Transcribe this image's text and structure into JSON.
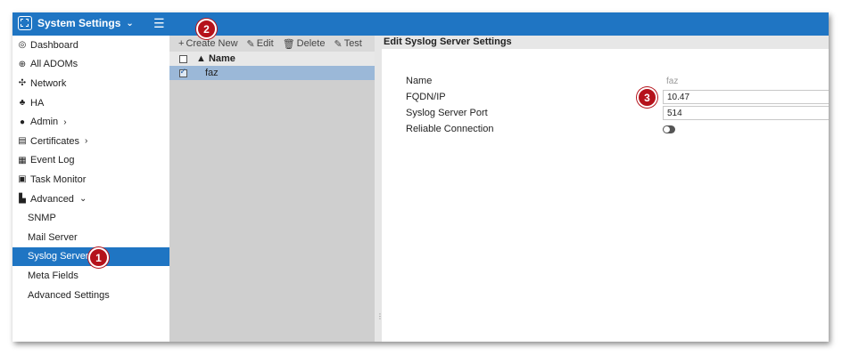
{
  "header": {
    "title": "System Settings",
    "chevron_icon": "chevron-down-icon",
    "menu_icon": "hamburger-icon",
    "bar_color": "#1f75c3"
  },
  "sidebar": {
    "items": [
      {
        "label": "Dashboard",
        "icon": "dashboard-icon"
      },
      {
        "label": "All ADOMs",
        "icon": "globe-icon"
      },
      {
        "label": "Network",
        "icon": "network-icon"
      },
      {
        "label": "HA",
        "icon": "ha-icon"
      },
      {
        "label": "Admin",
        "icon": "user-icon",
        "caret": "›"
      },
      {
        "label": "Certificates",
        "icon": "certificate-icon",
        "caret": "›"
      },
      {
        "label": "Event Log",
        "icon": "event-log-icon"
      },
      {
        "label": "Task Monitor",
        "icon": "task-monitor-icon"
      },
      {
        "label": "Advanced",
        "icon": "advanced-icon",
        "caret": "⌄"
      },
      {
        "label": "SNMP"
      },
      {
        "label": "Mail Server"
      },
      {
        "label": "Syslog Server",
        "active": true
      },
      {
        "label": "Meta Fields"
      },
      {
        "label": "Advanced Settings"
      }
    ]
  },
  "toolbar": {
    "create_label": "Create New",
    "edit_label": "Edit",
    "delete_label": "Delete",
    "test_label": "Test"
  },
  "table": {
    "column_header": "Name",
    "sort_indicator": "▲",
    "rows": [
      {
        "name": "faz",
        "selected": true
      }
    ]
  },
  "panel": {
    "title": "Edit Syslog Server Settings",
    "fields": {
      "name": {
        "label": "Name",
        "value": "faz"
      },
      "fqdn": {
        "label": "FQDN/IP",
        "value": "10.47"
      },
      "port": {
        "label": "Syslog Server Port",
        "value": "514"
      },
      "reliable": {
        "label": "Reliable Connection",
        "enabled": false
      }
    }
  },
  "annotations": {
    "step1": "1",
    "step2": "2",
    "step3": "3",
    "badge_color": "#b5121b"
  }
}
